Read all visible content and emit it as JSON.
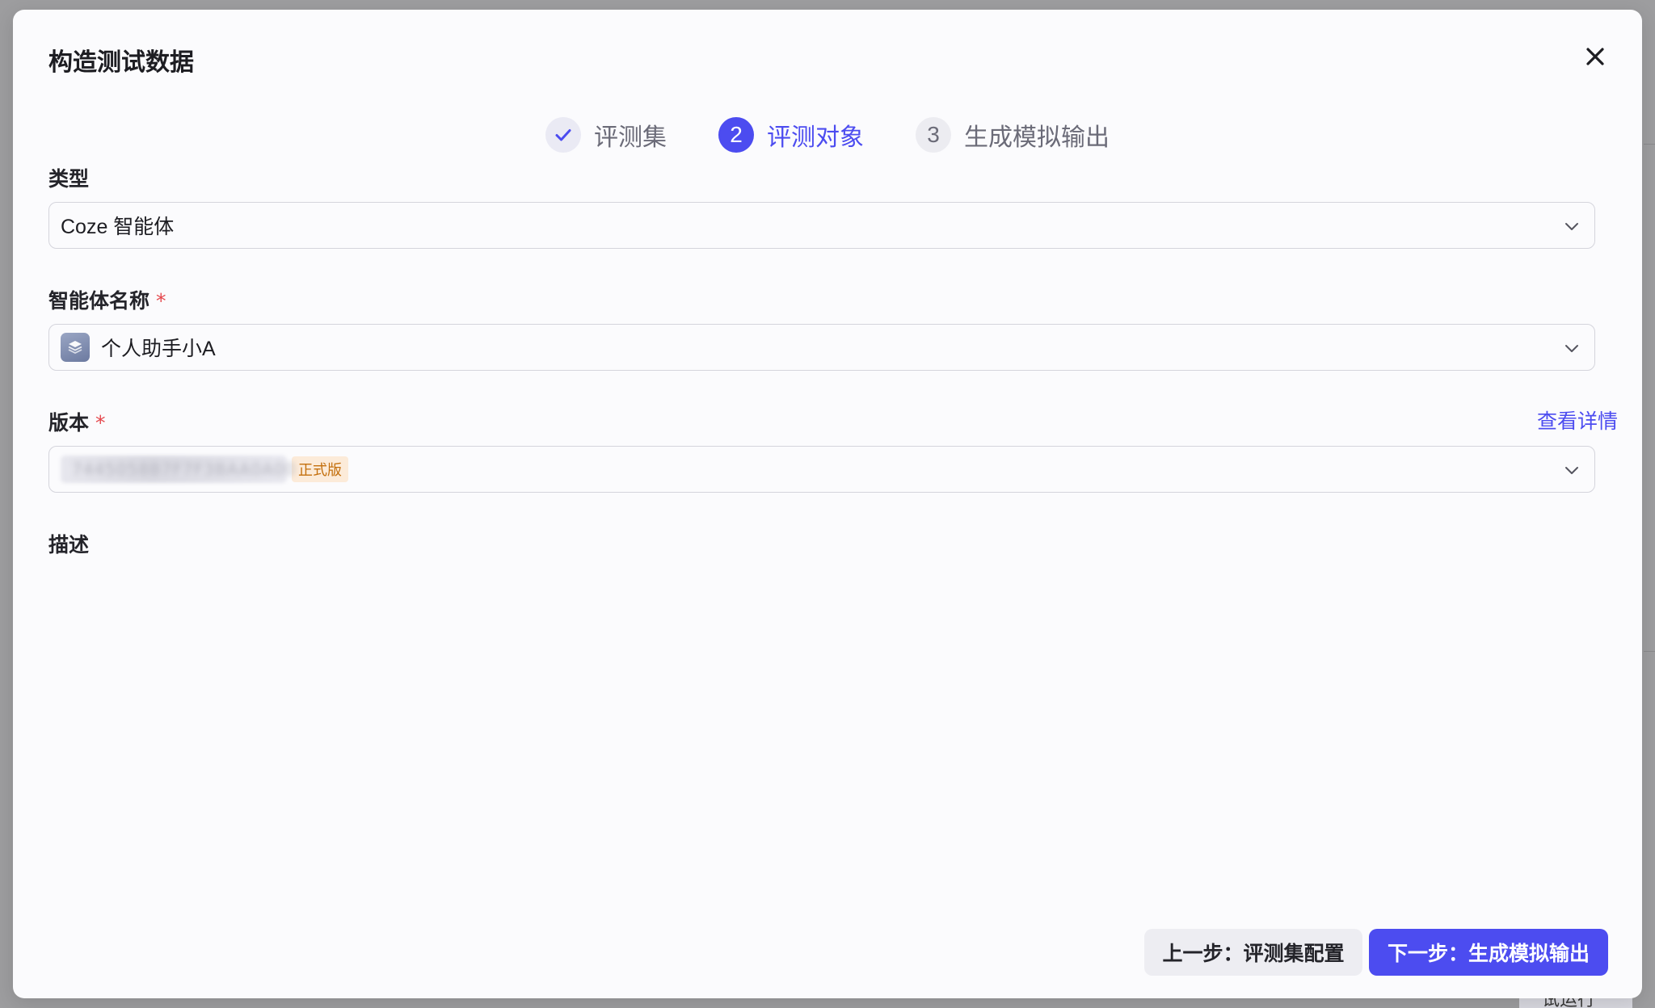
{
  "background": {
    "partial_button_text": "试运行"
  },
  "modal": {
    "title": "构造测试数据",
    "close_icon": "close-icon"
  },
  "steps": [
    {
      "label": "评测集",
      "state": "done",
      "marker": "check-icon"
    },
    {
      "label": "评测对象",
      "state": "active",
      "number": "2"
    },
    {
      "label": "生成模拟输出",
      "state": "pending",
      "number": "3"
    }
  ],
  "form": {
    "type": {
      "label": "类型",
      "value": "Coze 智能体"
    },
    "agent_name": {
      "label": "智能体名称",
      "required_mark": "*",
      "value": "个人助手小A",
      "avatar_icon": "agent-avatar-icon"
    },
    "version": {
      "label": "版本",
      "required_mark": "*",
      "detail_link": "查看详情",
      "value_obscured": "7445058B7F7F3BAA0A00",
      "badge": "正式版"
    },
    "description": {
      "label": "描述"
    }
  },
  "footer": {
    "prev_button": "上一步：评测集配置",
    "next_button": "下一步：生成模拟输出"
  },
  "colors": {
    "accent": "#4c4cf0",
    "required": "#e5484d",
    "badge_text": "#c4700e",
    "badge_bg": "#fcebd9"
  }
}
